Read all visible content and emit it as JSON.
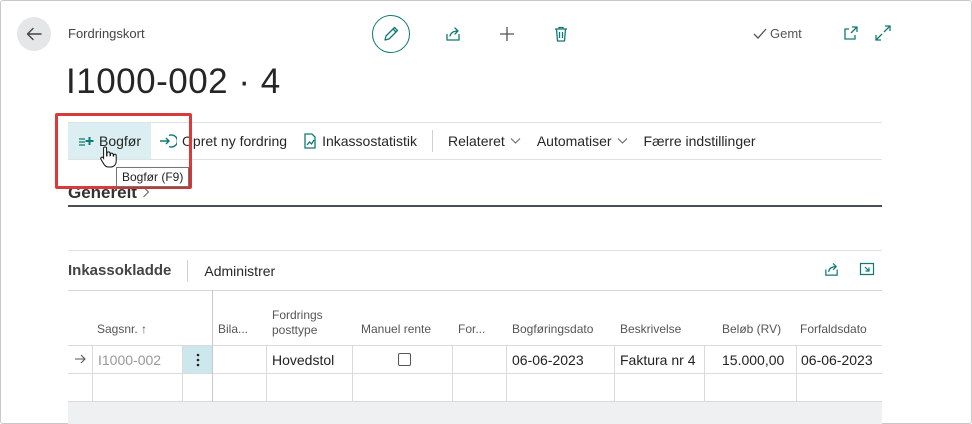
{
  "header": {
    "breadcrumb": "Fordringskort",
    "saved_label": "Gemt",
    "title": "I1000-002 · 4"
  },
  "actions": {
    "post": "Bogfør",
    "new_claim": "Opret ny fordring",
    "collection_stats": "Inkassostatistik",
    "related": "Relateret",
    "automate": "Automatiser",
    "fewer_options": "Færre indstillinger"
  },
  "tooltip": "Bogfør (F9)",
  "section": {
    "general": "Generelt"
  },
  "subpage": {
    "title": "Inkassokladde",
    "manage": "Administrer",
    "columns": {
      "case_no": "Sagsnr. ↑",
      "bila": "Bila...",
      "claim_type_line1": "Fordrings",
      "claim_type_line2": "posttype",
      "manual_interest": "Manuel rente",
      "for": "For...",
      "posting_date": "Bogføringsdato",
      "description": "Beskrivelse",
      "amount": "Beløb (RV)",
      "due_date": "Forfaldsdato"
    },
    "rows": [
      {
        "case_no": "I1000-002",
        "claim_type": "Hovedstol",
        "posting_date": "06-06-2023",
        "description": "Faktura nr 4",
        "amount": "15.000,00",
        "due_date": "06-06-2023"
      }
    ]
  },
  "colors": {
    "accent": "#0e7a73",
    "highlight": "#dbeff3",
    "annotation": "#d93a3a"
  }
}
